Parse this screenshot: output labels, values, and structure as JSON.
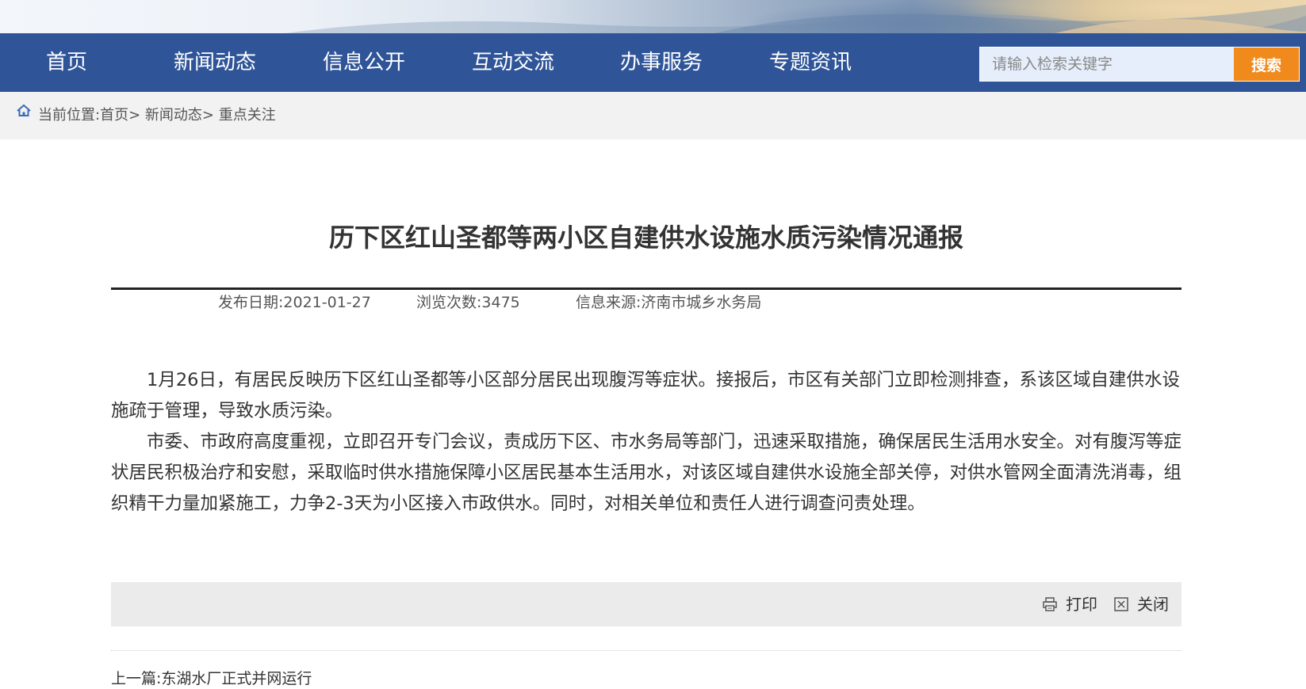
{
  "nav": {
    "items": [
      {
        "label": "首页"
      },
      {
        "label": "新闻动态"
      },
      {
        "label": "信息公开"
      },
      {
        "label": "互动交流"
      },
      {
        "label": "办事服务"
      },
      {
        "label": "专题资讯"
      }
    ],
    "search": {
      "placeholder": "请输入检索关键字",
      "button_label": "搜索"
    }
  },
  "breadcrumb": {
    "icon": "home-icon",
    "prefix": "当前位置:",
    "items": [
      {
        "label": "首页",
        "sep": ">"
      },
      {
        "label": "新闻动态",
        "sep": ">"
      },
      {
        "label": "重点关注",
        "sep": ""
      }
    ]
  },
  "article": {
    "title": "历下区红山圣都等两小区自建供水设施水质污染情况通报",
    "meta": {
      "date_label": "发布日期:",
      "date": "2021-01-27",
      "views_label": "浏览次数:",
      "views": "3475",
      "source_label": "信息来源:",
      "source": "济南市城乡水务局"
    },
    "paragraphs": [
      "1月26日，有居民反映历下区红山圣都等小区部分居民出现腹泻等症状。接报后，市区有关部门立即检测排查，系该区域自建供水设施疏于管理，导致水质污染。",
      "市委、市政府高度重视，立即召开专门会议，责成历下区、市水务局等部门，迅速采取措施，确保居民生活用水安全。对有腹泻等症状居民积极治疗和安慰，采取临时供水措施保障小区居民基本生活用水，对该区域自建供水设施全部关停，对供水管网全面清洗消毒，组织精干力量加紧施工，力争2-3天为小区接入市政供水。同时，对相关单位和责任人进行调查问责处理。"
    ]
  },
  "tools": {
    "print_label": "打印",
    "print_icon": "printer-icon",
    "close_label": "关闭",
    "close_icon": "close-box-icon"
  },
  "prev": {
    "label": "上一篇:",
    "title": "东湖水厂正式并网运行"
  },
  "colors": {
    "nav_bg": "#2f5598",
    "search_button": "#f08a1c",
    "breadcrumb_bg": "#f2f2f2",
    "tools_bg": "#ebebeb"
  }
}
